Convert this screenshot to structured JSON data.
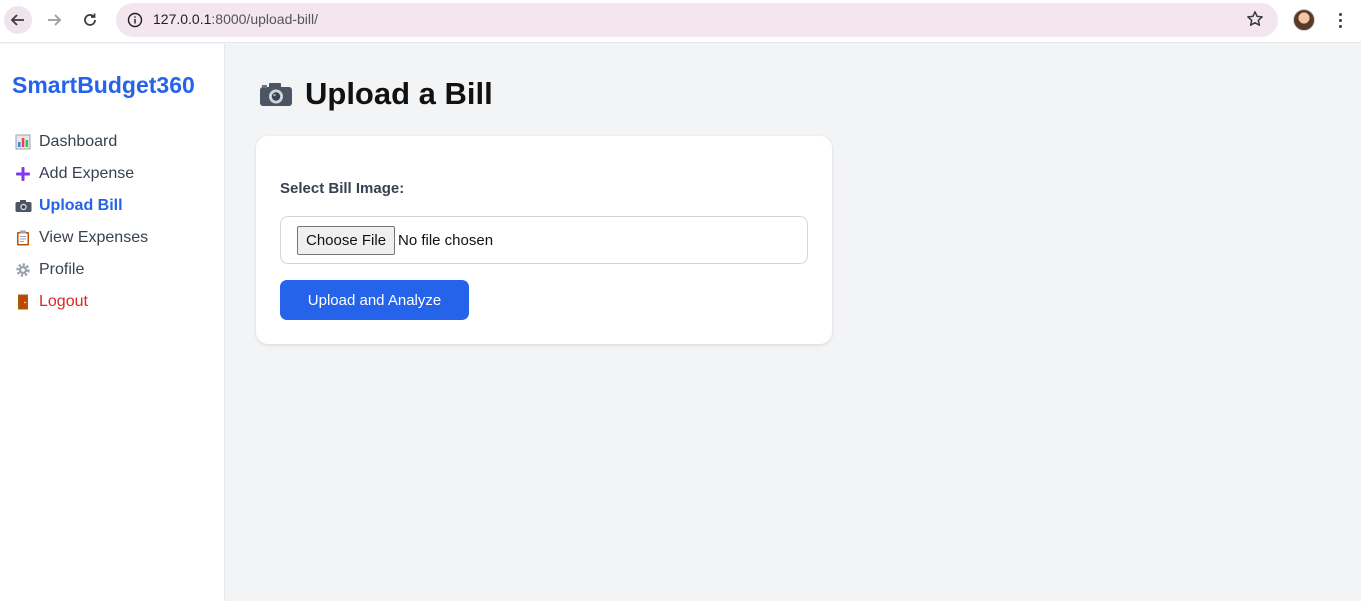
{
  "browser": {
    "url_host": "127.0.0.1",
    "url_path": ":8000/upload-bill/"
  },
  "sidebar": {
    "brand": "SmartBudget360",
    "items": [
      {
        "label": "Dashboard",
        "icon": "bar-chart-icon"
      },
      {
        "label": "Add Expense",
        "icon": "plus-icon"
      },
      {
        "label": "Upload Bill",
        "icon": "camera-icon",
        "active": true
      },
      {
        "label": "View Expenses",
        "icon": "clipboard-icon"
      },
      {
        "label": "Profile",
        "icon": "gear-icon"
      },
      {
        "label": "Logout",
        "icon": "door-icon"
      }
    ]
  },
  "main": {
    "title": "Upload a Bill",
    "form": {
      "label": "Select Bill Image:",
      "choose_button": "Choose File",
      "file_status": "No file chosen",
      "submit_label": "Upload and Analyze"
    }
  },
  "colors": {
    "accent": "#2563eb",
    "logout": "#dc2626",
    "background": "#f3f4f6"
  }
}
